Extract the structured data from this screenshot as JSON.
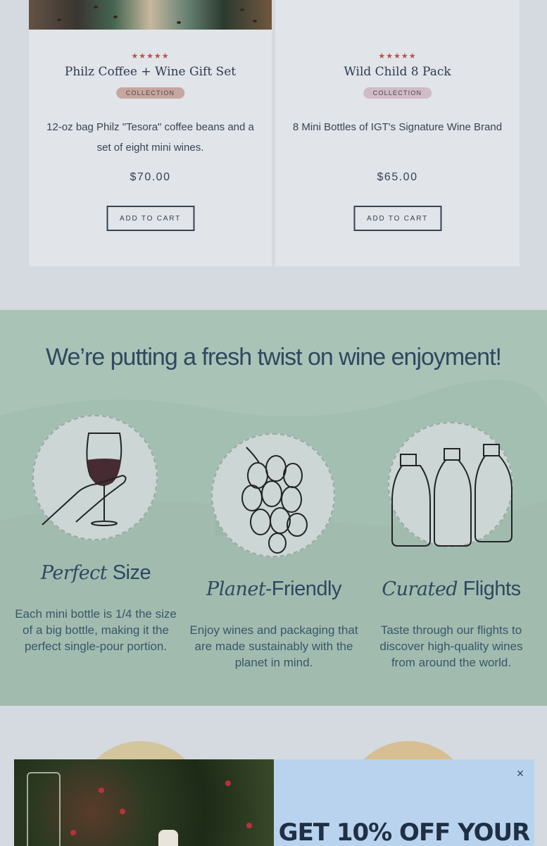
{
  "products": [
    {
      "stars": "★★★★★",
      "title": "Philz Coffee + Wine Gift Set",
      "badge": "COLLECTION",
      "description": "12-oz bag Philz \"Tesora\" coffee beans and a set of eight mini wines.",
      "price": "$70.00",
      "cta": "ADD TO CART"
    },
    {
      "stars": "★★★★★",
      "title": "Wild Child 8 Pack",
      "badge": "COLLECTION",
      "description": "8 Mini Bottles of IGT's Signature Wine Brand",
      "price": "$65.00",
      "cta": "ADD TO CART"
    }
  ],
  "feature": {
    "heading": "We’re putting a fresh twist on wine enjoyment!",
    "items": [
      {
        "title_italic": "Perfect",
        "title_rest": " Size",
        "text": "Each mini bottle is 1/4 the size of a big bottle, making it the perfect single-pour portion.",
        "icon": "wine-glass-hand-icon"
      },
      {
        "title_italic": "Planet-",
        "title_rest": "Friendly",
        "text": "Enjoy wines and packaging that are made sustainably with the planet in mind.",
        "icon": "grapes-icon"
      },
      {
        "title_italic": "Curated",
        "title_rest": " Flights",
        "text": "Taste through our flights to discover high-quality wines from around the world.",
        "icon": "mini-bottles-icon"
      }
    ]
  },
  "popup": {
    "close_label": "×",
    "offer_text": "GET 10% OFF YOUR"
  },
  "colors": {
    "stars": "#c4574f",
    "feature_bg": "#b8d3c4",
    "popup_bg": "#b9d3ee",
    "heading": "#2f4a62"
  }
}
